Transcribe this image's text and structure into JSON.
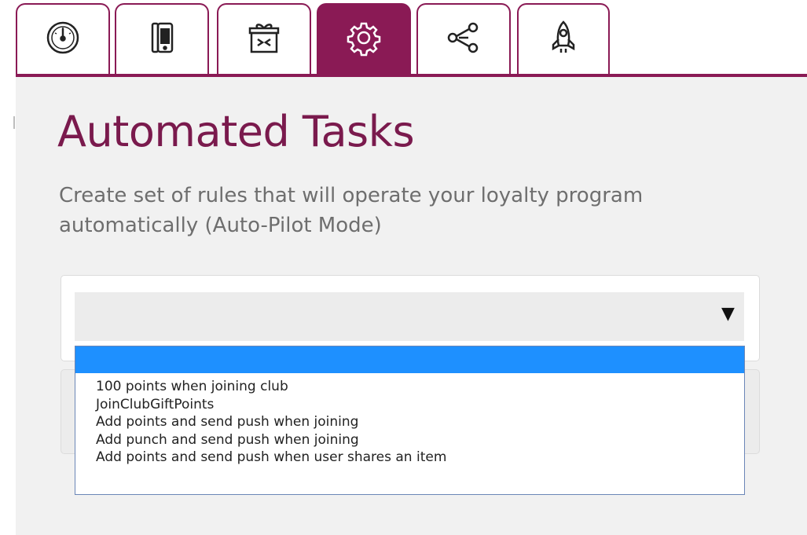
{
  "tabs": [
    {
      "icon": "gauge-icon",
      "active": false
    },
    {
      "icon": "mobile-phone-icon",
      "active": false
    },
    {
      "icon": "gift-icon",
      "active": false
    },
    {
      "icon": "gear-icon",
      "active": true
    },
    {
      "icon": "share-icon",
      "active": false
    },
    {
      "icon": "rocket-icon",
      "active": false
    }
  ],
  "colors": {
    "brand": "#8a1a55",
    "highlight": "#1e90ff",
    "panel": "#f1f1f1"
  },
  "page": {
    "title": "Automated Tasks",
    "description": "Create set of rules that will operate your loyalty program automatically (Auto-Pilot Mode)"
  },
  "select": {
    "selected_value": "",
    "arrow": "▼",
    "options": [
      "",
      "100 points when joining club",
      "JoinClubGiftPoints",
      "Add points and send push when joining",
      "Add punch and send push when joining",
      "Add points and send push when user shares an item"
    ]
  }
}
